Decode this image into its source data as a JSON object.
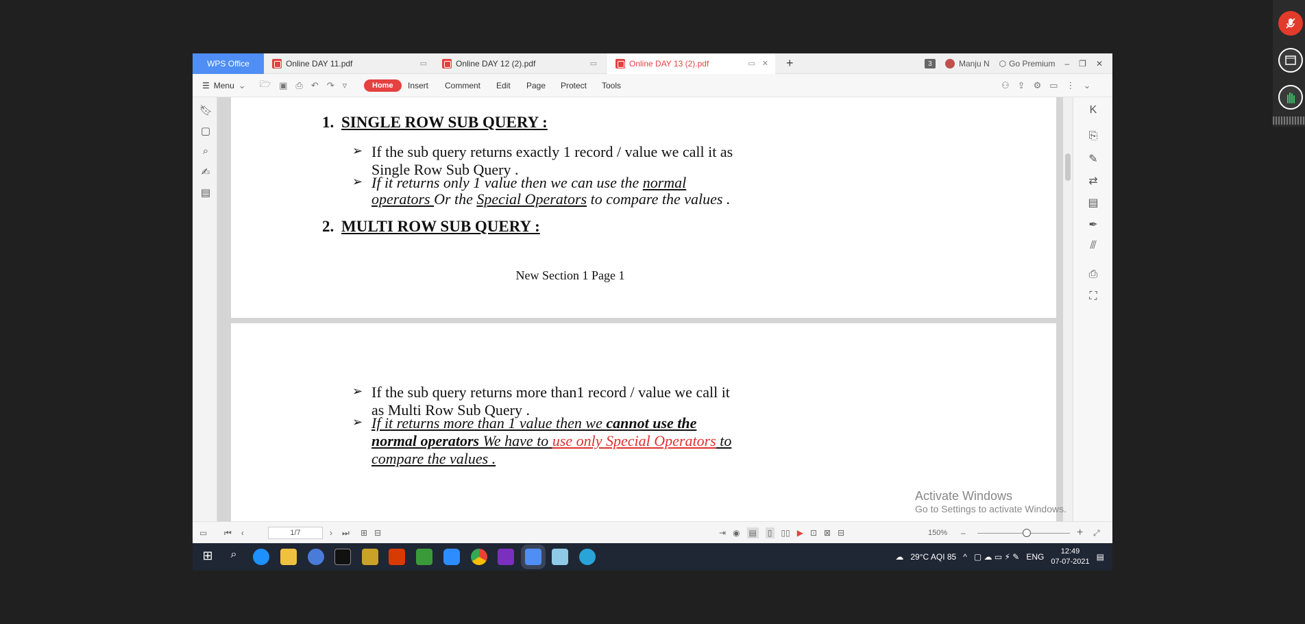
{
  "app": {
    "brand": "WPS Office",
    "user": "Manju N",
    "premium": "Go Premium",
    "tab_count": "3"
  },
  "tabs": [
    {
      "label": "Online DAY 11.pdf",
      "active": false
    },
    {
      "label": "Online DAY 12 (2).pdf",
      "active": false
    },
    {
      "label": "Online DAY 13 (2).pdf",
      "active": true
    }
  ],
  "menu": {
    "menu": "Menu",
    "items": [
      "Home",
      "Insert",
      "Comment",
      "Edit",
      "Page",
      "Protect",
      "Tools"
    ]
  },
  "doc": {
    "s1_num": "1.",
    "s1_title": "SINGLE ROW SUB QUERY :",
    "b1_l1": "If the sub query returns exactly 1 record / value we call it as",
    "b1_l2": "Single Row Sub Query .",
    "b2_a": "If it returns only 1 value then we can use the ",
    "b2_b": "normal",
    "b2_c": "operators ",
    "b2_d": "Or the ",
    "b2_e": "Special Operators",
    "b2_f": " to compare the values .",
    "s2_num": "2.",
    "s2_title": "MULTI ROW SUB QUERY :",
    "footer": "New Section 1 Page 1",
    "b3_l1": "If the sub query returns more than1 record / value we call it",
    "b3_l2": "as Multi Row Sub Query .",
    "b4_a": "If it returns more than 1 value then we ",
    "b4_b": "cannot use the",
    "b4_c": "normal operators",
    "b4_d": " We have to ",
    "b4_e": "use only Special Operators",
    "b4_f": " to",
    "b4_g": "compare the values ."
  },
  "status": {
    "page": "1/7",
    "zoom": "150%"
  },
  "activate": {
    "title": "Activate Windows",
    "sub": "Go to Settings to activate Windows."
  },
  "tray": {
    "weather": "29°C  AQI 85",
    "lang": "ENG",
    "time": "12:49",
    "date": "07-07-2021"
  }
}
